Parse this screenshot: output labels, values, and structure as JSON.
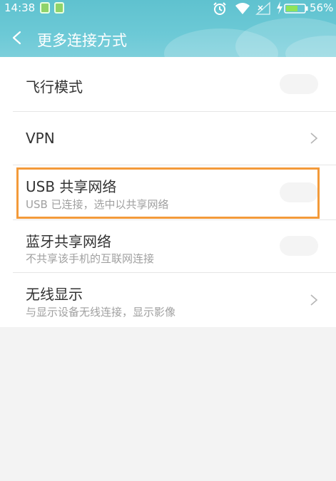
{
  "status_bar": {
    "time": "14:38",
    "battery_percent": "56%",
    "battery_level": 0.56,
    "icons": [
      "sim-icon",
      "sim-icon",
      "alarm-icon",
      "wifi-icon",
      "signal-icon",
      "charging-icon",
      "battery-icon"
    ]
  },
  "header": {
    "title": "更多连接方式",
    "back_icon": "chevron-left-icon"
  },
  "items": [
    {
      "title": "飞行模式",
      "control": "toggle",
      "enabled": false
    },
    {
      "title": "VPN",
      "control": "chevron"
    },
    {
      "title": "USB 共享网络",
      "subtitle": "USB 已连接，选中以共享网络",
      "control": "toggle",
      "enabled": false,
      "highlighted": true
    },
    {
      "title": "蓝牙共享网络",
      "subtitle": "不共享该手机的互联网连接",
      "control": "toggle",
      "enabled": false
    },
    {
      "title": "无线显示",
      "subtitle": "与显示设备无线连接，显示影像",
      "control": "chevron"
    }
  ],
  "colors": {
    "header": "#6cc9d6",
    "highlight": "#f39a3a",
    "background": "#f3f3f3"
  }
}
